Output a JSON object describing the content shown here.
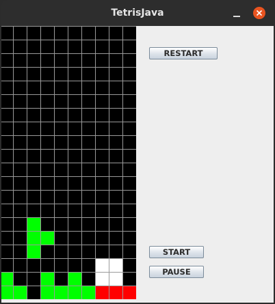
{
  "window": {
    "title": "TetrisJava"
  },
  "buttons": {
    "restart": "RESTART",
    "start": "START",
    "pause": "PAUSE"
  },
  "board": {
    "cols": 10,
    "rows": 20,
    "background": "#000000",
    "grid_color": "#9a9a9a",
    "cells": [
      {
        "col": 2,
        "row": 14,
        "color": "#00ff00"
      },
      {
        "col": 2,
        "row": 15,
        "color": "#00ff00"
      },
      {
        "col": 3,
        "row": 15,
        "color": "#00ff00"
      },
      {
        "col": 2,
        "row": 16,
        "color": "#00ff00"
      },
      {
        "col": 7,
        "row": 17,
        "color": "#ffffff"
      },
      {
        "col": 8,
        "row": 17,
        "color": "#ffffff"
      },
      {
        "col": 0,
        "row": 18,
        "color": "#00ff00"
      },
      {
        "col": 3,
        "row": 18,
        "color": "#00ff00"
      },
      {
        "col": 5,
        "row": 18,
        "color": "#00ff00"
      },
      {
        "col": 7,
        "row": 18,
        "color": "#ffffff"
      },
      {
        "col": 8,
        "row": 18,
        "color": "#ffffff"
      },
      {
        "col": 0,
        "row": 19,
        "color": "#00ff00"
      },
      {
        "col": 1,
        "row": 19,
        "color": "#00ff00"
      },
      {
        "col": 3,
        "row": 19,
        "color": "#00ff00"
      },
      {
        "col": 4,
        "row": 19,
        "color": "#00ff00"
      },
      {
        "col": 5,
        "row": 19,
        "color": "#00ff00"
      },
      {
        "col": 6,
        "row": 19,
        "color": "#00ff00"
      },
      {
        "col": 7,
        "row": 19,
        "color": "#ff0000"
      },
      {
        "col": 8,
        "row": 19,
        "color": "#ff0000"
      },
      {
        "col": 9,
        "row": 19,
        "color": "#ff0000"
      }
    ]
  },
  "colors": {
    "close_button": "#e95420",
    "titlebar": "#2d2d2d",
    "panel": "#eeeeee"
  }
}
